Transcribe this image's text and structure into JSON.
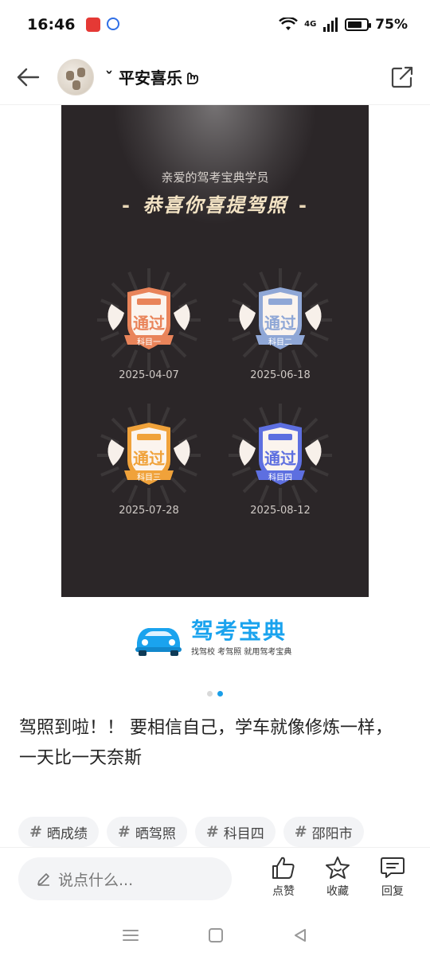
{
  "status_bar": {
    "time": "16:46",
    "network": "4G",
    "battery": "75%",
    "battery_level": 0.75
  },
  "header": {
    "username": "ˇ  平安喜乐",
    "back_icon": "arrow-left-icon",
    "share_icon": "share-external-icon"
  },
  "poster": {
    "subtitle": "亲爱的驾考宝典学员",
    "title": "恭喜你喜提驾照",
    "title_dash": "-",
    "badges": [
      {
        "label": "通过",
        "subject": "科目一",
        "date": "2025-04-07",
        "color": "#e9845a"
      },
      {
        "label": "通过",
        "subject": "科目二",
        "date": "2025-06-18",
        "color": "#8fa7d6"
      },
      {
        "label": "通过",
        "subject": "科目三",
        "date": "2025-07-28",
        "color": "#f0a23a"
      },
      {
        "label": "通过",
        "subject": "科目四",
        "date": "2025-08-12",
        "color": "#5d6fe0"
      }
    ]
  },
  "brand": {
    "name": "驾考宝典",
    "slogan": "找驾校 考驾照 就用驾考宝典"
  },
  "carousel": {
    "current": 2,
    "total": 2
  },
  "post": {
    "text": "驾照到啦！！ 要相信自己，学车就像修炼一样，一天比一天奈斯"
  },
  "tags": [
    "晒成绩",
    "晒驾照",
    "科目四",
    "邵阳市"
  ],
  "actions": {
    "comment_placeholder": "说点什么...",
    "like_label": "点赞",
    "favorite_label": "收藏",
    "reply_label": "回复"
  }
}
